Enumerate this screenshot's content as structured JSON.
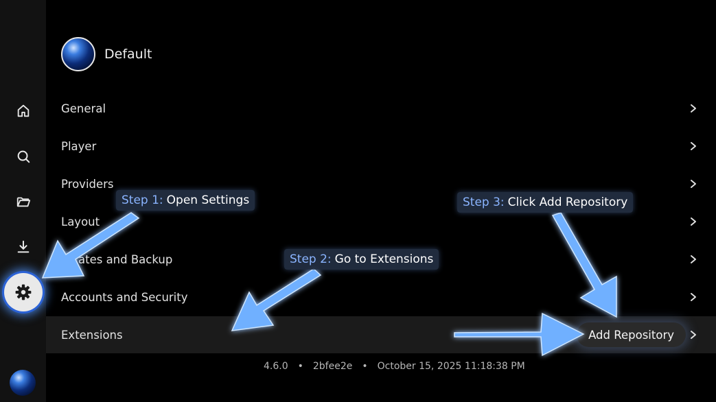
{
  "profile": {
    "name": "Default"
  },
  "sidebar": {
    "items": [
      {
        "icon": "home-icon"
      },
      {
        "icon": "search-icon"
      },
      {
        "icon": "folder-icon"
      },
      {
        "icon": "download-icon"
      },
      {
        "icon": "gear-icon",
        "active": true
      },
      {
        "icon": "avatar"
      }
    ]
  },
  "settings": {
    "items": [
      {
        "label": "General"
      },
      {
        "label": "Player"
      },
      {
        "label": "Providers"
      },
      {
        "label": "Layout"
      },
      {
        "label": "ates and Backup"
      },
      {
        "label": "Accounts and Security"
      },
      {
        "label": "Extensions",
        "selected": true,
        "action_label": "Add Repository"
      }
    ]
  },
  "footer": {
    "version": "4.6.0",
    "sep1": "•",
    "commit": "2bfee2e",
    "sep2": "•",
    "date": "October 15, 2025 11:18:38 PM"
  },
  "annotations": {
    "step1": {
      "prefix": "Step 1:",
      "text": "Open Settings"
    },
    "step2": {
      "prefix": "Step 2:",
      "text": "Go to Extensions"
    },
    "step3": {
      "prefix": "Step 3:",
      "text": "Click Add Repository"
    }
  },
  "colors": {
    "accent": "#2b62d6",
    "arrow": "#6fb0ff",
    "background": "#000000",
    "sidebar": "#121212",
    "selected_row": "#1b1b1b"
  }
}
